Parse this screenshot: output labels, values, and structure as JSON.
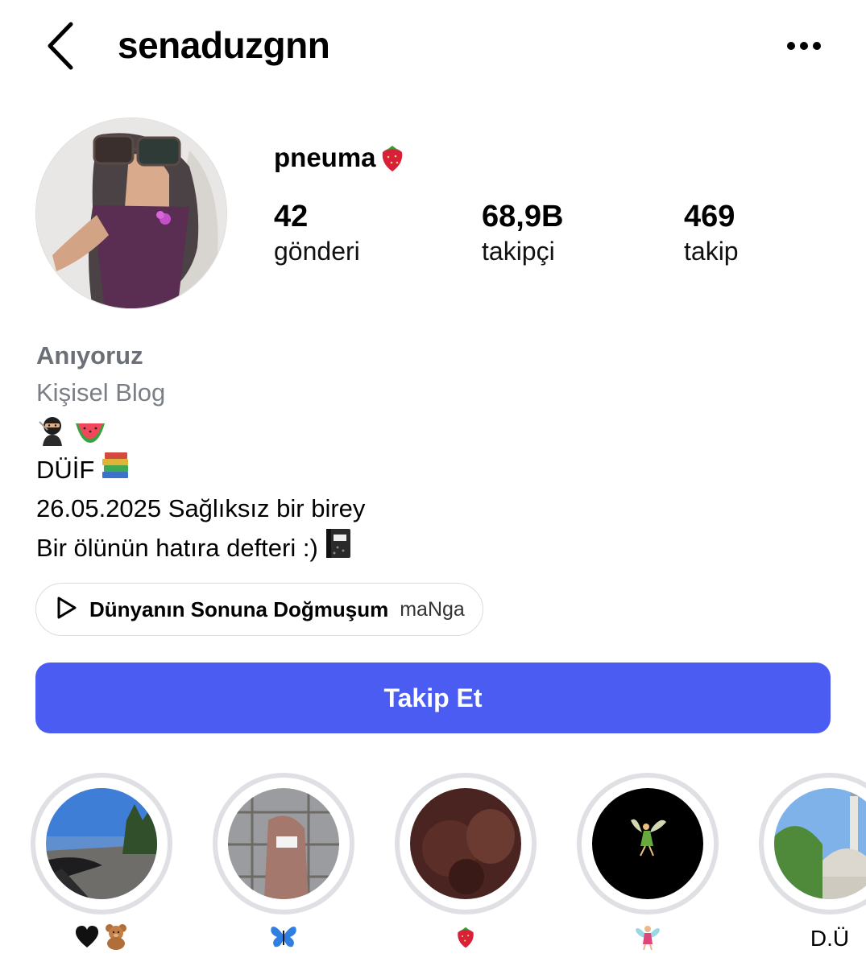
{
  "header": {
    "username": "senaduzgnn",
    "back_icon": "chevron-left-icon",
    "more_icon": "more-horizontal-icon"
  },
  "profile": {
    "display_name": "pneuma",
    "display_name_emoji": "strawberry",
    "stats": [
      {
        "value": "42",
        "label": "gönderi"
      },
      {
        "value": "68,9B",
        "label": "takipçi"
      },
      {
        "value": "469",
        "label": "takip"
      }
    ]
  },
  "bio": {
    "name": "Anıyoruz",
    "category": "Kişisel Blog",
    "emoji_line": [
      "ninja",
      "watermelon"
    ],
    "line_2": "DÜİF",
    "line_2_emoji": "books",
    "line_3": "26.05.2025 Sağlıksız bir birey",
    "line_4": "Bir ölünün hatıra defteri :)",
    "line_4_emoji": "notebook"
  },
  "music": {
    "song": "Dünyanın Sonuna Doğmuşum",
    "artist": "maNga",
    "icon": "play-icon"
  },
  "actions": {
    "follow_label": "Takip Et",
    "follow_color": "#4a5cf2"
  },
  "highlights": [
    {
      "caption": "",
      "caption_emoji": [
        "black-heart",
        "teddy-bear"
      ],
      "thumb": "road"
    },
    {
      "caption": "",
      "caption_emoji": [
        "butterfly"
      ],
      "thumb": "portrait"
    },
    {
      "caption": "",
      "caption_emoji": [
        "strawberry"
      ],
      "thumb": "dark-red"
    },
    {
      "caption": "",
      "caption_emoji": [
        "fairy"
      ],
      "thumb": "black-fairy"
    },
    {
      "caption": "D.Ü",
      "caption_emoji": [],
      "thumb": "mosque"
    }
  ]
}
